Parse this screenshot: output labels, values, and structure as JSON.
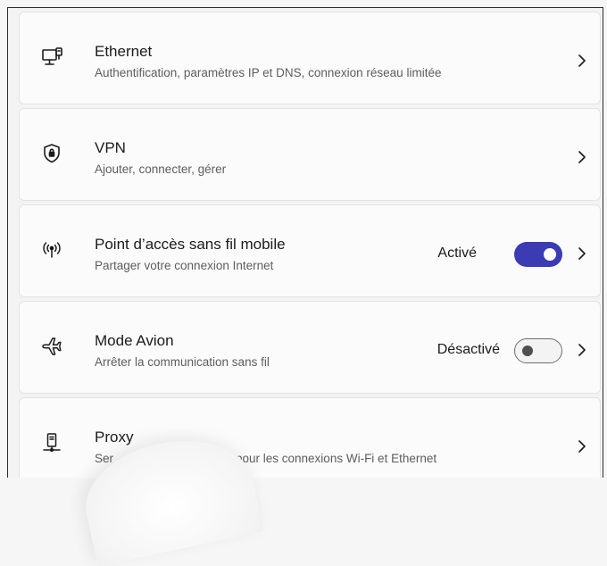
{
  "items": [
    {
      "title": "Ethernet",
      "description": "Authentification, paramètres IP et DNS, connexion réseau limitée",
      "icon": "ethernet-icon"
    },
    {
      "title": "VPN",
      "description": "Ajouter, connecter, gérer",
      "icon": "vpn-shield-icon"
    },
    {
      "title": "Point d’accès sans fil mobile",
      "description": "Partager votre connexion Internet",
      "icon": "hotspot-icon",
      "state": "Activé",
      "toggle": "on"
    },
    {
      "title": "Mode Avion",
      "description": "Arrêter la communication sans fil",
      "icon": "airplane-icon",
      "state": "Désactivé",
      "toggle": "off"
    },
    {
      "title": "Proxy",
      "description_visible_left": "Ser",
      "description_visible_right": "pour les connexions Wi-Fi et Ethernet",
      "icon": "proxy-icon"
    }
  ],
  "colors": {
    "accent": "#3b3bb3",
    "card": "#fbfbfb",
    "background": "#f3f3f3",
    "secondary_text": "#5d5d5d"
  }
}
